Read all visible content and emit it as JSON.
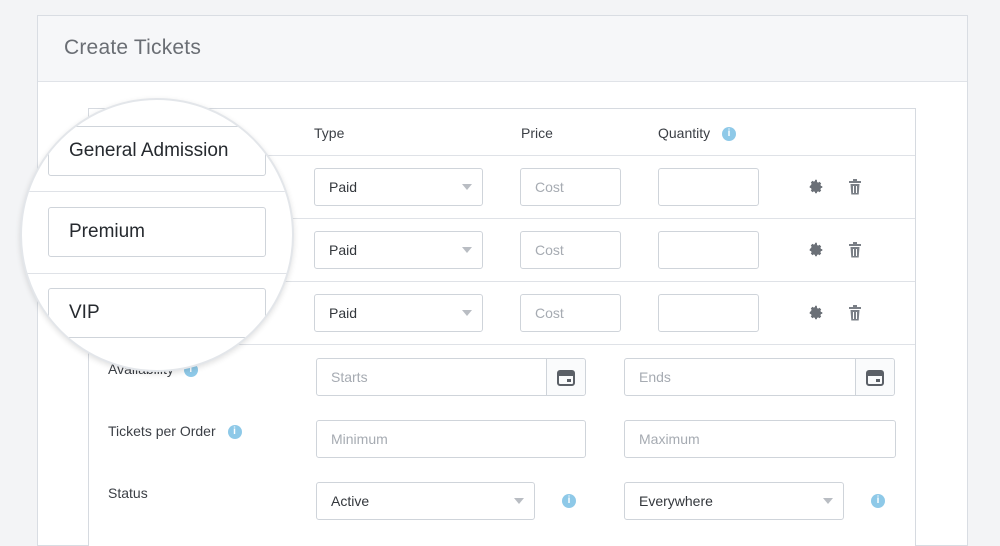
{
  "page": {
    "title": "Create Tickets"
  },
  "columns": {
    "type": "Type",
    "price": "Price",
    "quantity": "Quantity"
  },
  "tickets": [
    {
      "name": "General Admission",
      "type": "Paid",
      "price_placeholder": "Cost",
      "quantity": ""
    },
    {
      "name": "Premium",
      "type": "Paid",
      "price_placeholder": "Cost",
      "quantity": ""
    },
    {
      "name": "VIP",
      "type": "Paid",
      "price_placeholder": "Cost",
      "quantity": ""
    }
  ],
  "settings": {
    "availability": {
      "label": "Availability",
      "start_placeholder": "Starts",
      "end_placeholder": "Ends"
    },
    "tickets_per_order": {
      "label": "Tickets per Order",
      "min_placeholder": "Minimum",
      "max_placeholder": "Maximum"
    },
    "status": {
      "label": "Status",
      "value": "Active",
      "visibility": "Everywhere"
    }
  },
  "colors": {
    "info_icon": "#8ec9e8",
    "border": "#cfd4da",
    "header_bg": "#f6f7f9"
  },
  "icons": {
    "info": "info-icon",
    "settings": "gear-icon",
    "delete": "trash-icon",
    "calendar": "calendar-icon"
  }
}
